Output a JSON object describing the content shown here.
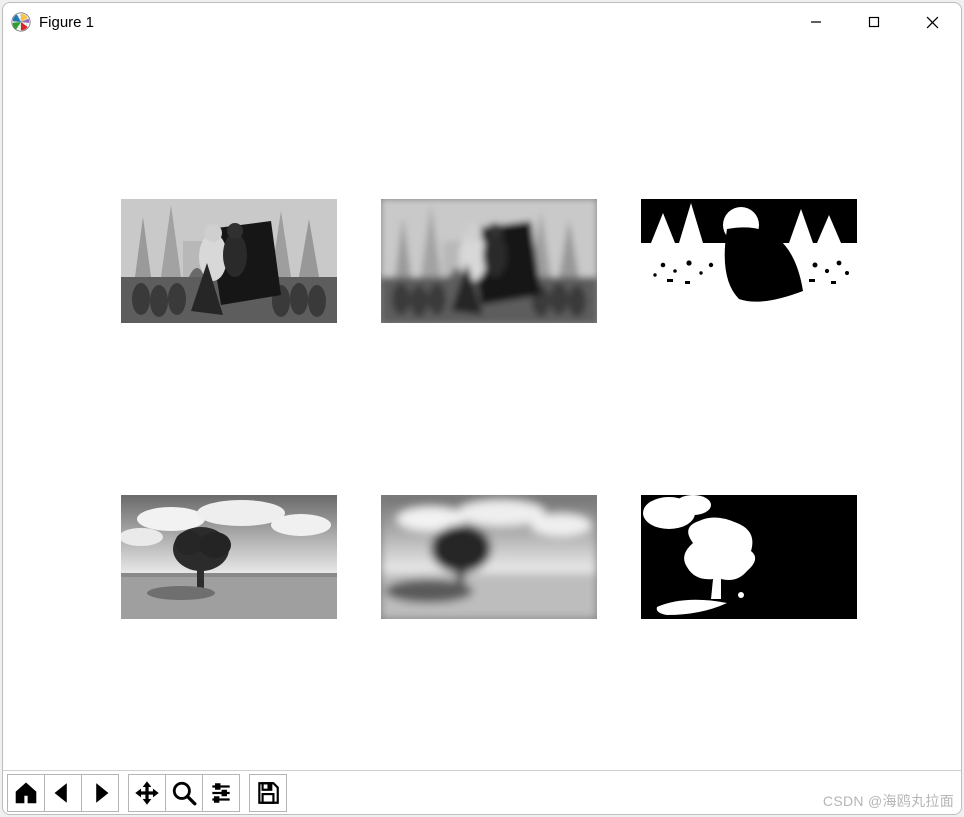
{
  "window": {
    "title": "Figure 1"
  },
  "toolbar": {
    "home": "Reset original view",
    "back": "Back to previous view",
    "forward": "Forward to next view",
    "pan": "Pan axes",
    "zoom": "Zoom to rectangle",
    "configure": "Configure subplots",
    "save": "Save the figure"
  },
  "subplots": {
    "rows": 2,
    "cols": 3,
    "items": [
      {
        "id": "r0c0",
        "desc": "grayscale photo, medieval scene, figures and spires"
      },
      {
        "id": "r0c1",
        "desc": "blurred grayscale version of medieval scene"
      },
      {
        "id": "r0c2",
        "desc": "black/white threshold mask of medieval scene"
      },
      {
        "id": "r1c0",
        "desc": "grayscale photo, single tree on horizon with clouds"
      },
      {
        "id": "r1c1",
        "desc": "blurred grayscale version of tree photo"
      },
      {
        "id": "r1c2",
        "desc": "black/white threshold mask of tree photo"
      }
    ]
  },
  "watermark": "CSDN @海鸥丸拉面"
}
